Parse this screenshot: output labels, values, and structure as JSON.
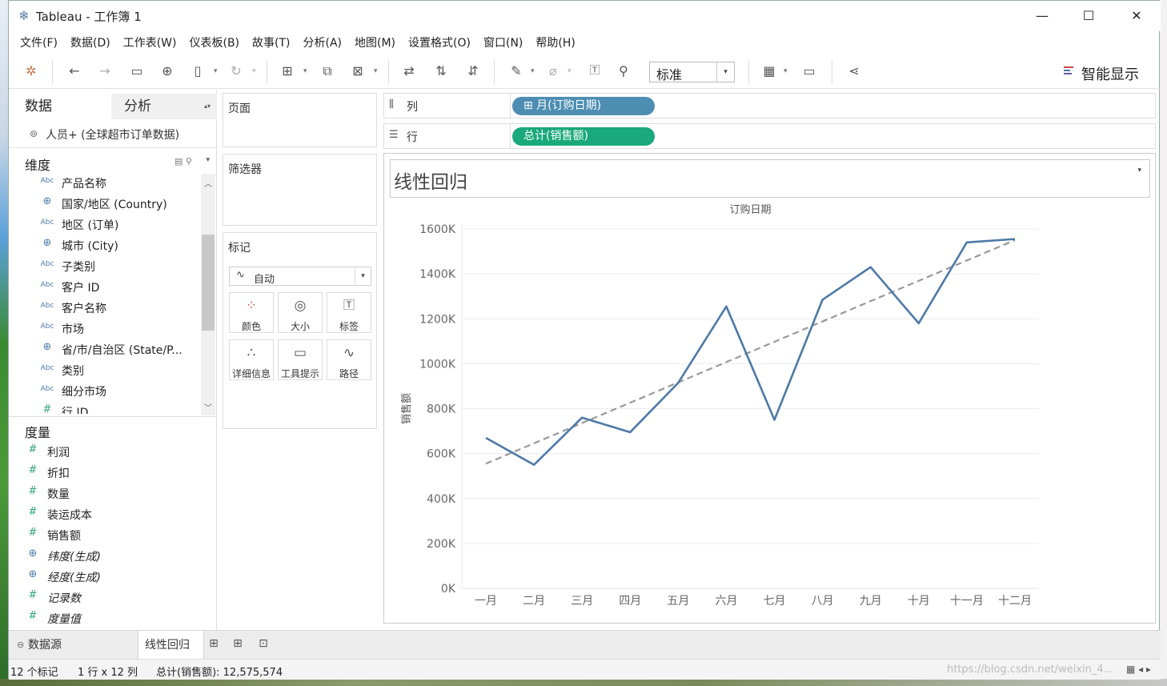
{
  "window": {
    "title": "Tableau - 工作簿 1",
    "minimize": "—",
    "maximize": "☐",
    "close": "✕"
  },
  "menu": [
    "文件(F)",
    "数据(D)",
    "工作表(W)",
    "仪表板(B)",
    "故事(T)",
    "分析(A)",
    "地图(M)",
    "设置格式(O)",
    "窗口(N)",
    "帮助(H)"
  ],
  "toolbar": {
    "fit_select": "标准",
    "show_me": "智能显示"
  },
  "data_pane": {
    "tab_data": "数据",
    "tab_analysis": "分析",
    "data_source": "人员+ (全球超市订单数据)",
    "dimensions_title": "维度",
    "dimensions": [
      {
        "type": "Abc",
        "name": "产品名称"
      },
      {
        "type": "geo",
        "name": "国家/地区 (Country)"
      },
      {
        "type": "Abc",
        "name": "地区 (订单)"
      },
      {
        "type": "geo",
        "name": "城市 (City)"
      },
      {
        "type": "Abc",
        "name": "子类别"
      },
      {
        "type": "Abc",
        "name": "客户 ID"
      },
      {
        "type": "Abc",
        "name": "客户名称"
      },
      {
        "type": "Abc",
        "name": "市场"
      },
      {
        "type": "geo",
        "name": "省/市/自治区 (State/P..."
      },
      {
        "type": "Abc",
        "name": "类别"
      },
      {
        "type": "Abc",
        "name": "细分市场"
      },
      {
        "type": "num",
        "name": "行 ID"
      }
    ],
    "measures_title": "度量",
    "measures": [
      {
        "type": "num",
        "name": "利润",
        "italic": false
      },
      {
        "type": "num",
        "name": "折扣",
        "italic": false
      },
      {
        "type": "num",
        "name": "数量",
        "italic": false
      },
      {
        "type": "num",
        "name": "装运成本",
        "italic": false
      },
      {
        "type": "num",
        "name": "销售额",
        "italic": false
      },
      {
        "type": "geo",
        "name": "纬度(生成)",
        "italic": true
      },
      {
        "type": "geo",
        "name": "经度(生成)",
        "italic": true
      },
      {
        "type": "num",
        "name": "记录数",
        "italic": true
      },
      {
        "type": "num",
        "name": "度量值",
        "italic": true
      }
    ]
  },
  "cards": {
    "pages": "页面",
    "filters": "筛选器",
    "marks": "标记",
    "mark_type": "自动",
    "mark_buttons": [
      "颜色",
      "大小",
      "标签",
      "详细信息",
      "工具提示",
      "路径"
    ]
  },
  "shelves": {
    "columns_label": "列",
    "columns_pill": "⊞ 月(订购日期)",
    "rows_label": "行",
    "rows_pill": "总计(销售额)"
  },
  "view": {
    "title": "线性回归"
  },
  "chart_data": {
    "type": "line",
    "title": "",
    "xlabel": "订购日期",
    "ylabel": "销售额",
    "categories": [
      "一月",
      "二月",
      "三月",
      "四月",
      "五月",
      "六月",
      "七月",
      "八月",
      "九月",
      "十月",
      "十一月",
      "十二月"
    ],
    "series": [
      {
        "name": "",
        "values": [
          670000,
          550000,
          760000,
          695000,
          915000,
          1255000,
          750000,
          1285000,
          1430000,
          1180000,
          1540000,
          1555000
        ],
        "color": "#4e79a7"
      }
    ],
    "trend_line": {
      "start": 555000,
      "end": 1550000,
      "color": "#999999",
      "style": "dashed"
    },
    "yticks": [
      "0K",
      "200K",
      "400K",
      "600K",
      "800K",
      "1000K",
      "1200K",
      "1400K",
      "1600K"
    ],
    "ylim": [
      0,
      1600000
    ],
    "grid": true
  },
  "sheets": {
    "data_source_tab": "数据源",
    "active_sheet": "线性回归"
  },
  "status": {
    "marks": "12 个标记",
    "dims": "1 行 x 12 列",
    "sum": "总计(销售额): 12,575,574",
    "watermark": "https://blog.csdn.net/weixin_4..."
  }
}
